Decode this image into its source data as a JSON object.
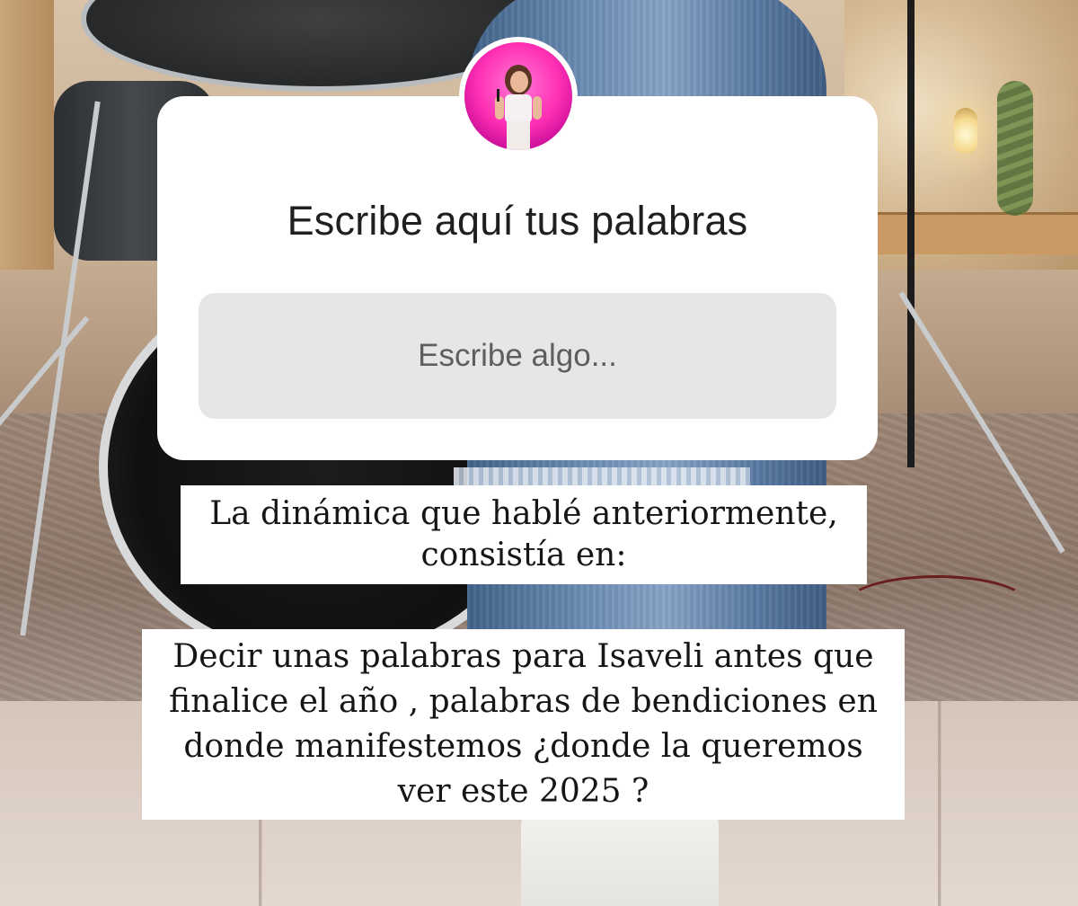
{
  "question_sticker": {
    "title": "Escribe aquí tus palabras",
    "answer_placeholder": "Escribe algo...",
    "avatar_gradient": [
      "#ff2fb3",
      "#c400a0"
    ]
  },
  "captions": {
    "intro_lines": [
      "La dinámica que hablé anteriormente,",
      "consistía en:"
    ],
    "body_lines": [
      "Decir unas palabras para Isaveli antes que",
      "finalice el año , palabras de bendiciones en",
      "donde manifestemos  ¿donde la queremos",
      "ver este 2025 ?"
    ]
  },
  "colors": {
    "sticker_bg": "#ffffff",
    "input_bg": "#e6e6e6",
    "avatar_accent": "#ff2fb3"
  }
}
